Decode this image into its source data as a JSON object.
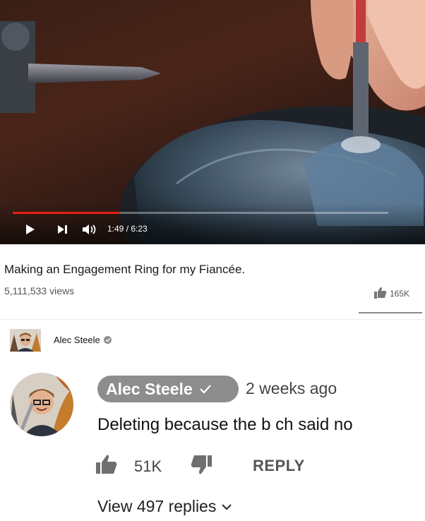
{
  "player": {
    "time_display": "1:49 / 6:23",
    "progress": 0.285,
    "accent_color": "#e62117",
    "controls": [
      "play-icon",
      "next-icon",
      "volume-icon"
    ]
  },
  "video": {
    "title": "Making an Engagement Ring for my Fiancée.",
    "views": "5,111,533 views",
    "likes": "165K"
  },
  "channel": {
    "name": "Alec Steele"
  },
  "comment": {
    "author": "Alec Steele",
    "time": "2 weeks ago",
    "text": "Deleting because the b  ch said no",
    "likes": "51K",
    "reply_label": "REPLY",
    "view_replies": "View 497 replies"
  }
}
